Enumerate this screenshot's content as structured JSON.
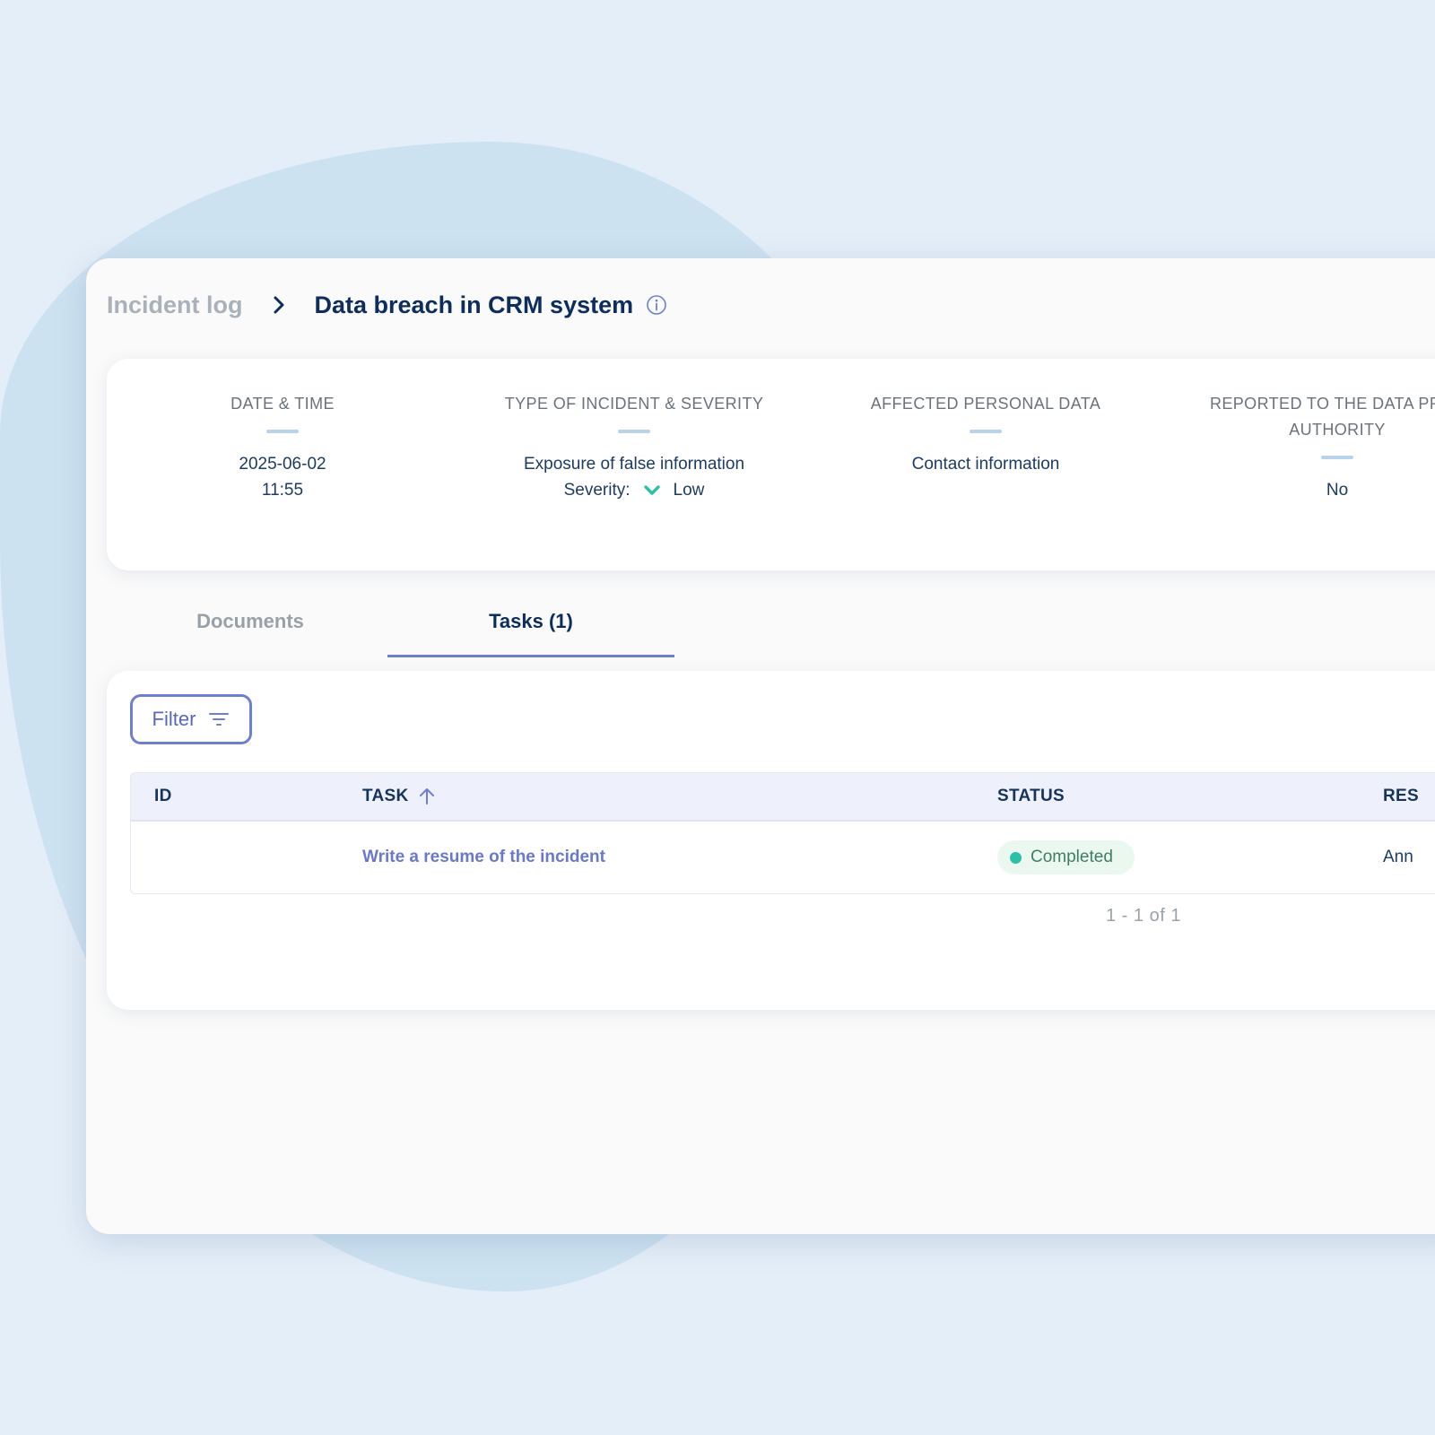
{
  "colors": {
    "background": "#e4eef8",
    "blob": "#cde2f1",
    "title": "#0d2d5c",
    "accent": "#6f7fd0",
    "status_completed_dot": "#2bc0a8",
    "status_completed_bg": "#eaf8f0"
  },
  "breadcrumb": {
    "parent": "Incident log",
    "current": "Data breach in CRM system",
    "separator_icon": "chevron-right-icon",
    "info_icon": "info-icon"
  },
  "summary": {
    "date_time": {
      "label": "DATE & TIME",
      "date": "2025-06-02",
      "time": "11:55"
    },
    "type_severity": {
      "label": "TYPE OF INCIDENT & SEVERITY",
      "type": "Exposure of false information",
      "severity_label": "Severity:",
      "severity_icon": "chevron-down-icon",
      "severity_value": "Low"
    },
    "affected_data": {
      "label": "AFFECTED PERSONAL DATA",
      "value": "Contact information"
    },
    "reported": {
      "label_line1": "REPORTED TO THE DATA PROT",
      "label_line2": "AUTHORITY",
      "value": "No"
    }
  },
  "tabs": [
    {
      "label": "Documents",
      "active": false
    },
    {
      "label": "Tasks (1)",
      "active": true
    }
  ],
  "filter": {
    "label": "Filter",
    "icon": "filter-icon"
  },
  "table": {
    "columns": [
      "ID",
      "TASK",
      "STATUS",
      "RES"
    ],
    "sort_icon": "arrow-up-icon",
    "rows": [
      {
        "id": "",
        "task": "Write a resume of the incident",
        "status": "Completed",
        "responsible": "Ann"
      }
    ]
  },
  "pagination": "1 - 1 of 1"
}
